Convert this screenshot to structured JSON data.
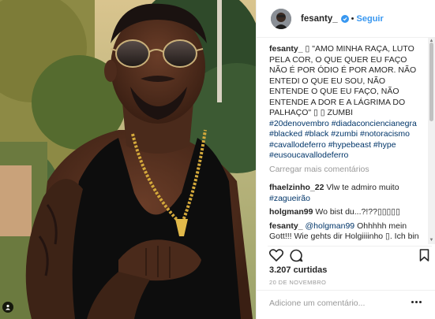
{
  "post": {
    "username": "fesanty_",
    "follow_separator": "•",
    "follow_label": "Seguir",
    "comments": [
      {
        "user": "fesanty_",
        "text": " ▯ \"AMO MINHA RAÇA, LUTO PELA COR, O QUE QUER EU FAÇO NÃO É POR ÓDIO É POR AMOR. NÃO ENTEDI O QUE EU SOU, NÃO ENTENDE O QUE EU FAÇO, NÃO ENTENDE A DOR E A LÁGRIMA DO PALHAÇO\" ▯ ▯ ZUMBI",
        "tags": "#20denovembro #diadaconciencianegra #blacked #black #zumbi #notoracismo #cavallodeferro #hypebeast #hype #eusoucavallodeferro"
      }
    ],
    "load_more_label": "Carregar mais comentários",
    "replies": [
      {
        "user": "fhaelzinho_22",
        "text": " Vlw te admiro muito ",
        "tag": "#zagueirão"
      },
      {
        "user": "holgman99",
        "text": " Wo bist du...?!??▯▯▯▯▯"
      },
      {
        "user": "fesanty_",
        "mention": " @holgman99",
        "text": " Ohhhhh mein Gott!!! Wie gehts dir Holgiiiinho ▯. Ich bin in Brasilien mein Freund... in Dezember ich fliege nach Deutschland dann ich komme vorbei ok? La Tele"
      }
    ],
    "likes": "3.207 curtidas",
    "date": "20 DE NOVEMBRO",
    "add_comment_placeholder": "Adicione um comentário..."
  },
  "icons": [
    "heart-icon",
    "comment-icon",
    "bookmark-icon",
    "more-options-icon",
    "verified-badge-icon",
    "user-tag-icon"
  ],
  "colors": {
    "link": "#3897f0",
    "text": "#262626",
    "muted": "#999999",
    "tag": "#003569",
    "border": "#efefef"
  }
}
